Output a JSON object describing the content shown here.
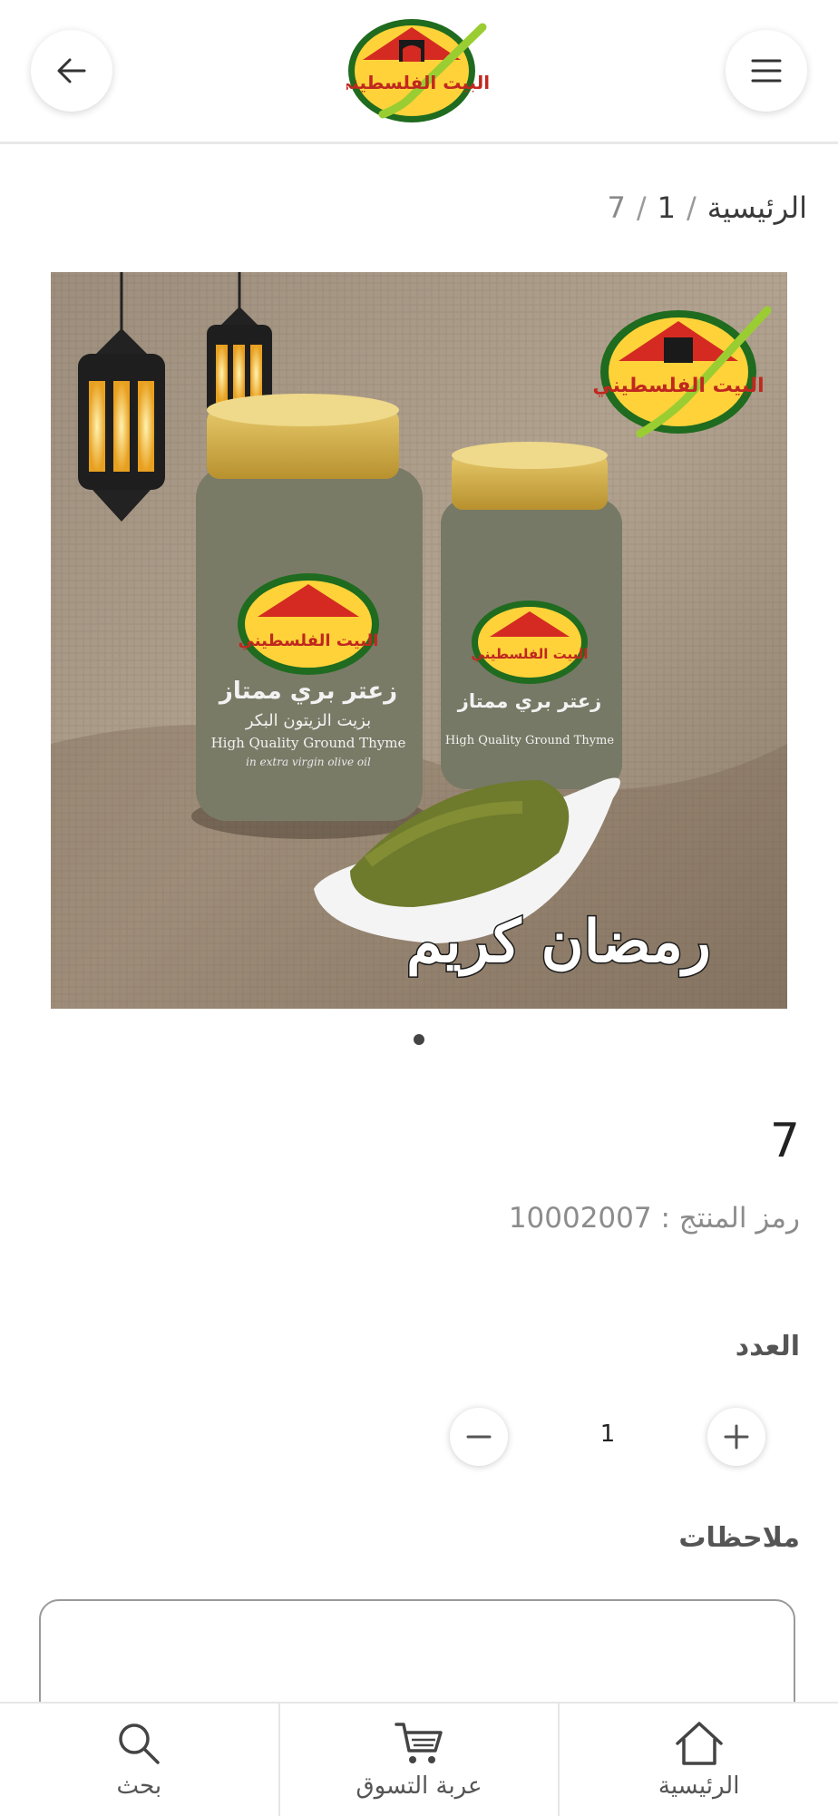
{
  "header": {
    "back_icon": "arrow-left-icon",
    "menu_icon": "hamburger-menu-icon",
    "logo_text": "البيت الفلسطيني"
  },
  "breadcrumb": {
    "home": "الرئيسية",
    "separator": "/",
    "category": "1",
    "current": "7"
  },
  "product_image": {
    "logo_text": "البيت الفلسطيني",
    "jar_label_arabic": "زعتر بري ممتاز",
    "jar_label_arabic_2": "بزيت الزيتون البكر",
    "jar_label_english": "High Quality Ground Thyme",
    "jar_label_english_2": "in extra virgin olive oil",
    "greeting": "رمضان كريم"
  },
  "carousel": {
    "current_slide": 1,
    "total_slides": 1
  },
  "product": {
    "title": "7",
    "sku_text": "رمز المنتج : 10002007"
  },
  "quantity": {
    "label": "العدد",
    "value": "1",
    "plus_icon": "plus-icon",
    "minus_icon": "minus-icon"
  },
  "notes": {
    "label": "ملاحظات",
    "placeholder": ""
  },
  "bottom_nav": {
    "items": [
      {
        "label": "بحث",
        "icon": "search-icon"
      },
      {
        "label": "عربة التسوق",
        "icon": "shopping-cart-icon"
      },
      {
        "label": "الرئيسية",
        "icon": "home-icon"
      }
    ]
  },
  "colors": {
    "brand_green": "#1f6b1f",
    "brand_red": "#d42a22",
    "brand_yellow": "#ffd23a",
    "checkmark_green": "#9acd32"
  }
}
